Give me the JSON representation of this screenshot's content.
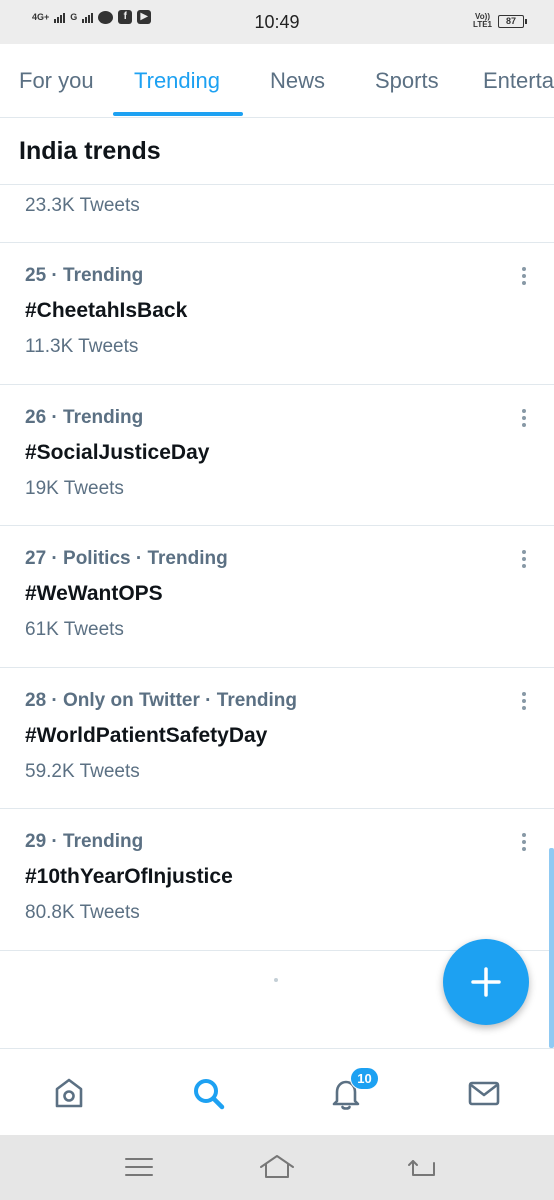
{
  "status_bar": {
    "time": "10:49",
    "network_4g": "4G+",
    "network_g": "G",
    "volte": "Vo)) LTE1",
    "volte_line1": "Vo))",
    "volte_line2": "LTE1",
    "battery": "87",
    "icons": [
      "signal-icon",
      "chat-bubble-icon",
      "facebook-icon",
      "youtube-icon"
    ]
  },
  "tabs": [
    {
      "label": "For you",
      "active": false
    },
    {
      "label": "Trending",
      "active": true
    },
    {
      "label": "News",
      "active": false
    },
    {
      "label": "Sports",
      "active": false
    },
    {
      "label": "Entertainment",
      "active": false
    }
  ],
  "section": {
    "title": "India trends"
  },
  "partial_item": {
    "count": "23.3K Tweets"
  },
  "trends": [
    {
      "meta": "25 · Trending",
      "name": "#CheetahIsBack",
      "count": "11.3K Tweets"
    },
    {
      "meta": "26 · Trending",
      "name": "#SocialJusticeDay",
      "count": "19K Tweets"
    },
    {
      "meta": "27 · Politics · Trending",
      "name": "#WeWantOPS",
      "count": "61K Tweets"
    },
    {
      "meta": "28 · Only on Twitter · Trending",
      "name": "#WorldPatientSafetyDay",
      "count": "59.2K Tweets"
    },
    {
      "meta": "29 · Trending",
      "name": "#10thYearOfInjustice",
      "count": "80.8K Tweets"
    }
  ],
  "fab": {
    "icon": "plus-icon"
  },
  "bottom_nav": {
    "items": [
      {
        "icon": "home-icon",
        "active": false
      },
      {
        "icon": "search-icon",
        "active": true
      },
      {
        "icon": "notifications-icon",
        "active": false
      },
      {
        "icon": "messages-icon",
        "active": false
      }
    ],
    "notification_badge": "10"
  },
  "android_nav": {
    "icons": [
      "menu-icon",
      "home-outline-icon",
      "back-icon"
    ]
  },
  "colors": {
    "accent": "#1da1f2",
    "text_primary": "#0f1419",
    "text_secondary": "#5b7083",
    "divider": "#e1e8ed",
    "status_bar_bg": "#ededed"
  }
}
